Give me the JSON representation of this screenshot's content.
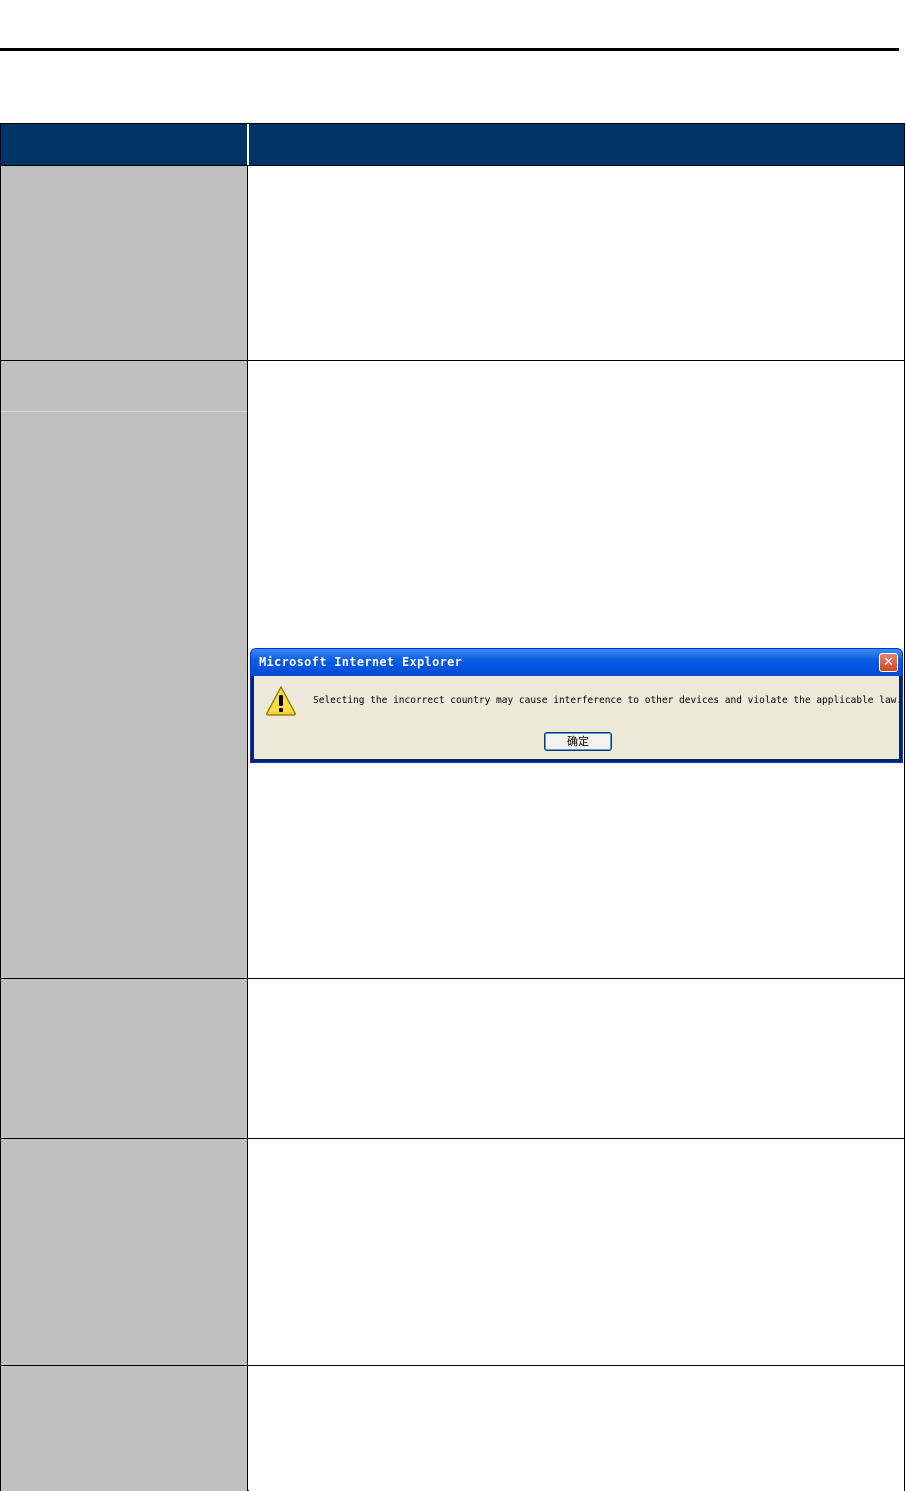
{
  "dialog": {
    "title": "Microsoft Internet Explorer",
    "message": "Selecting the incorrect country may cause interference to other devices and violate the applicable law.",
    "ok_label": "确定",
    "icons": {
      "warning": "warning-icon",
      "close": "close-icon"
    }
  },
  "colors": {
    "header_bar": "#003366",
    "label_column": "#c0c0c0",
    "rule": "#000000"
  }
}
